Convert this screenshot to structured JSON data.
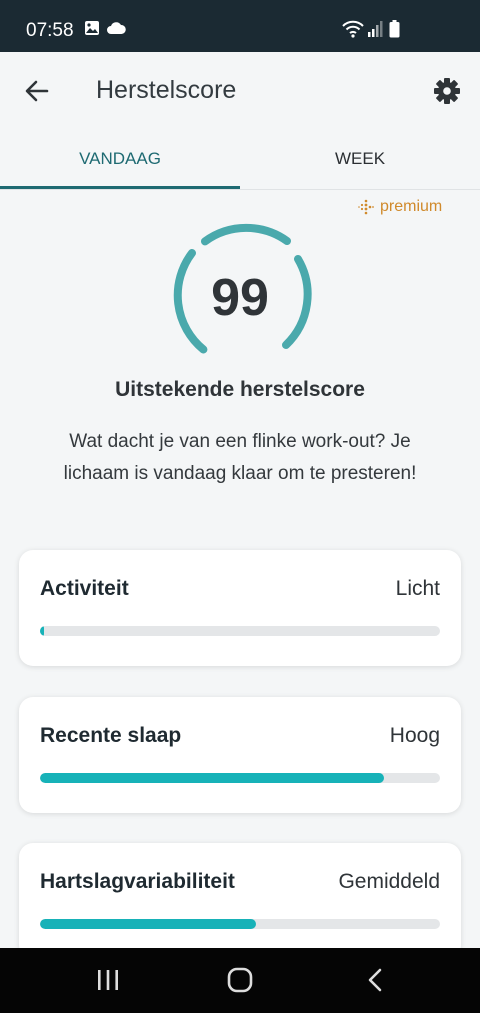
{
  "status_bar": {
    "time": "07:58",
    "left_icons": [
      "image-icon",
      "cloud-icon"
    ],
    "right_icons": [
      "wifi-icon",
      "signal-icon",
      "battery-icon"
    ]
  },
  "app_bar": {
    "title": "Herstelscore",
    "back_icon": "arrow-left-icon",
    "settings_icon": "gear-icon"
  },
  "tabs": [
    {
      "label": "VANDAAG",
      "active": true
    },
    {
      "label": "WEEK",
      "active": false
    }
  ],
  "premium_badge": "premium",
  "score": {
    "value": "99",
    "headline": "Uitstekende herstelscore",
    "description": "Wat dacht je van een flinke work-out? Je lichaam is vandaag klaar om te presteren!"
  },
  "metrics": [
    {
      "label": "Activiteit",
      "value": "Licht",
      "fraction": 0.01
    },
    {
      "label": "Recente slaap",
      "value": "Hoog",
      "fraction": 0.86
    },
    {
      "label": "Hartslagvariabiliteit",
      "value": "Gemiddeld",
      "fraction": 0.54
    }
  ],
  "colors": {
    "status_bar": "#1b2a33",
    "accent": "#1e6a72",
    "gauge": "#4aa9ac",
    "bar_fill": "#17b2b8",
    "premium": "#d08a2c"
  },
  "nav_bar": {
    "icons": [
      "recents-icon",
      "home-icon",
      "back-icon"
    ]
  }
}
